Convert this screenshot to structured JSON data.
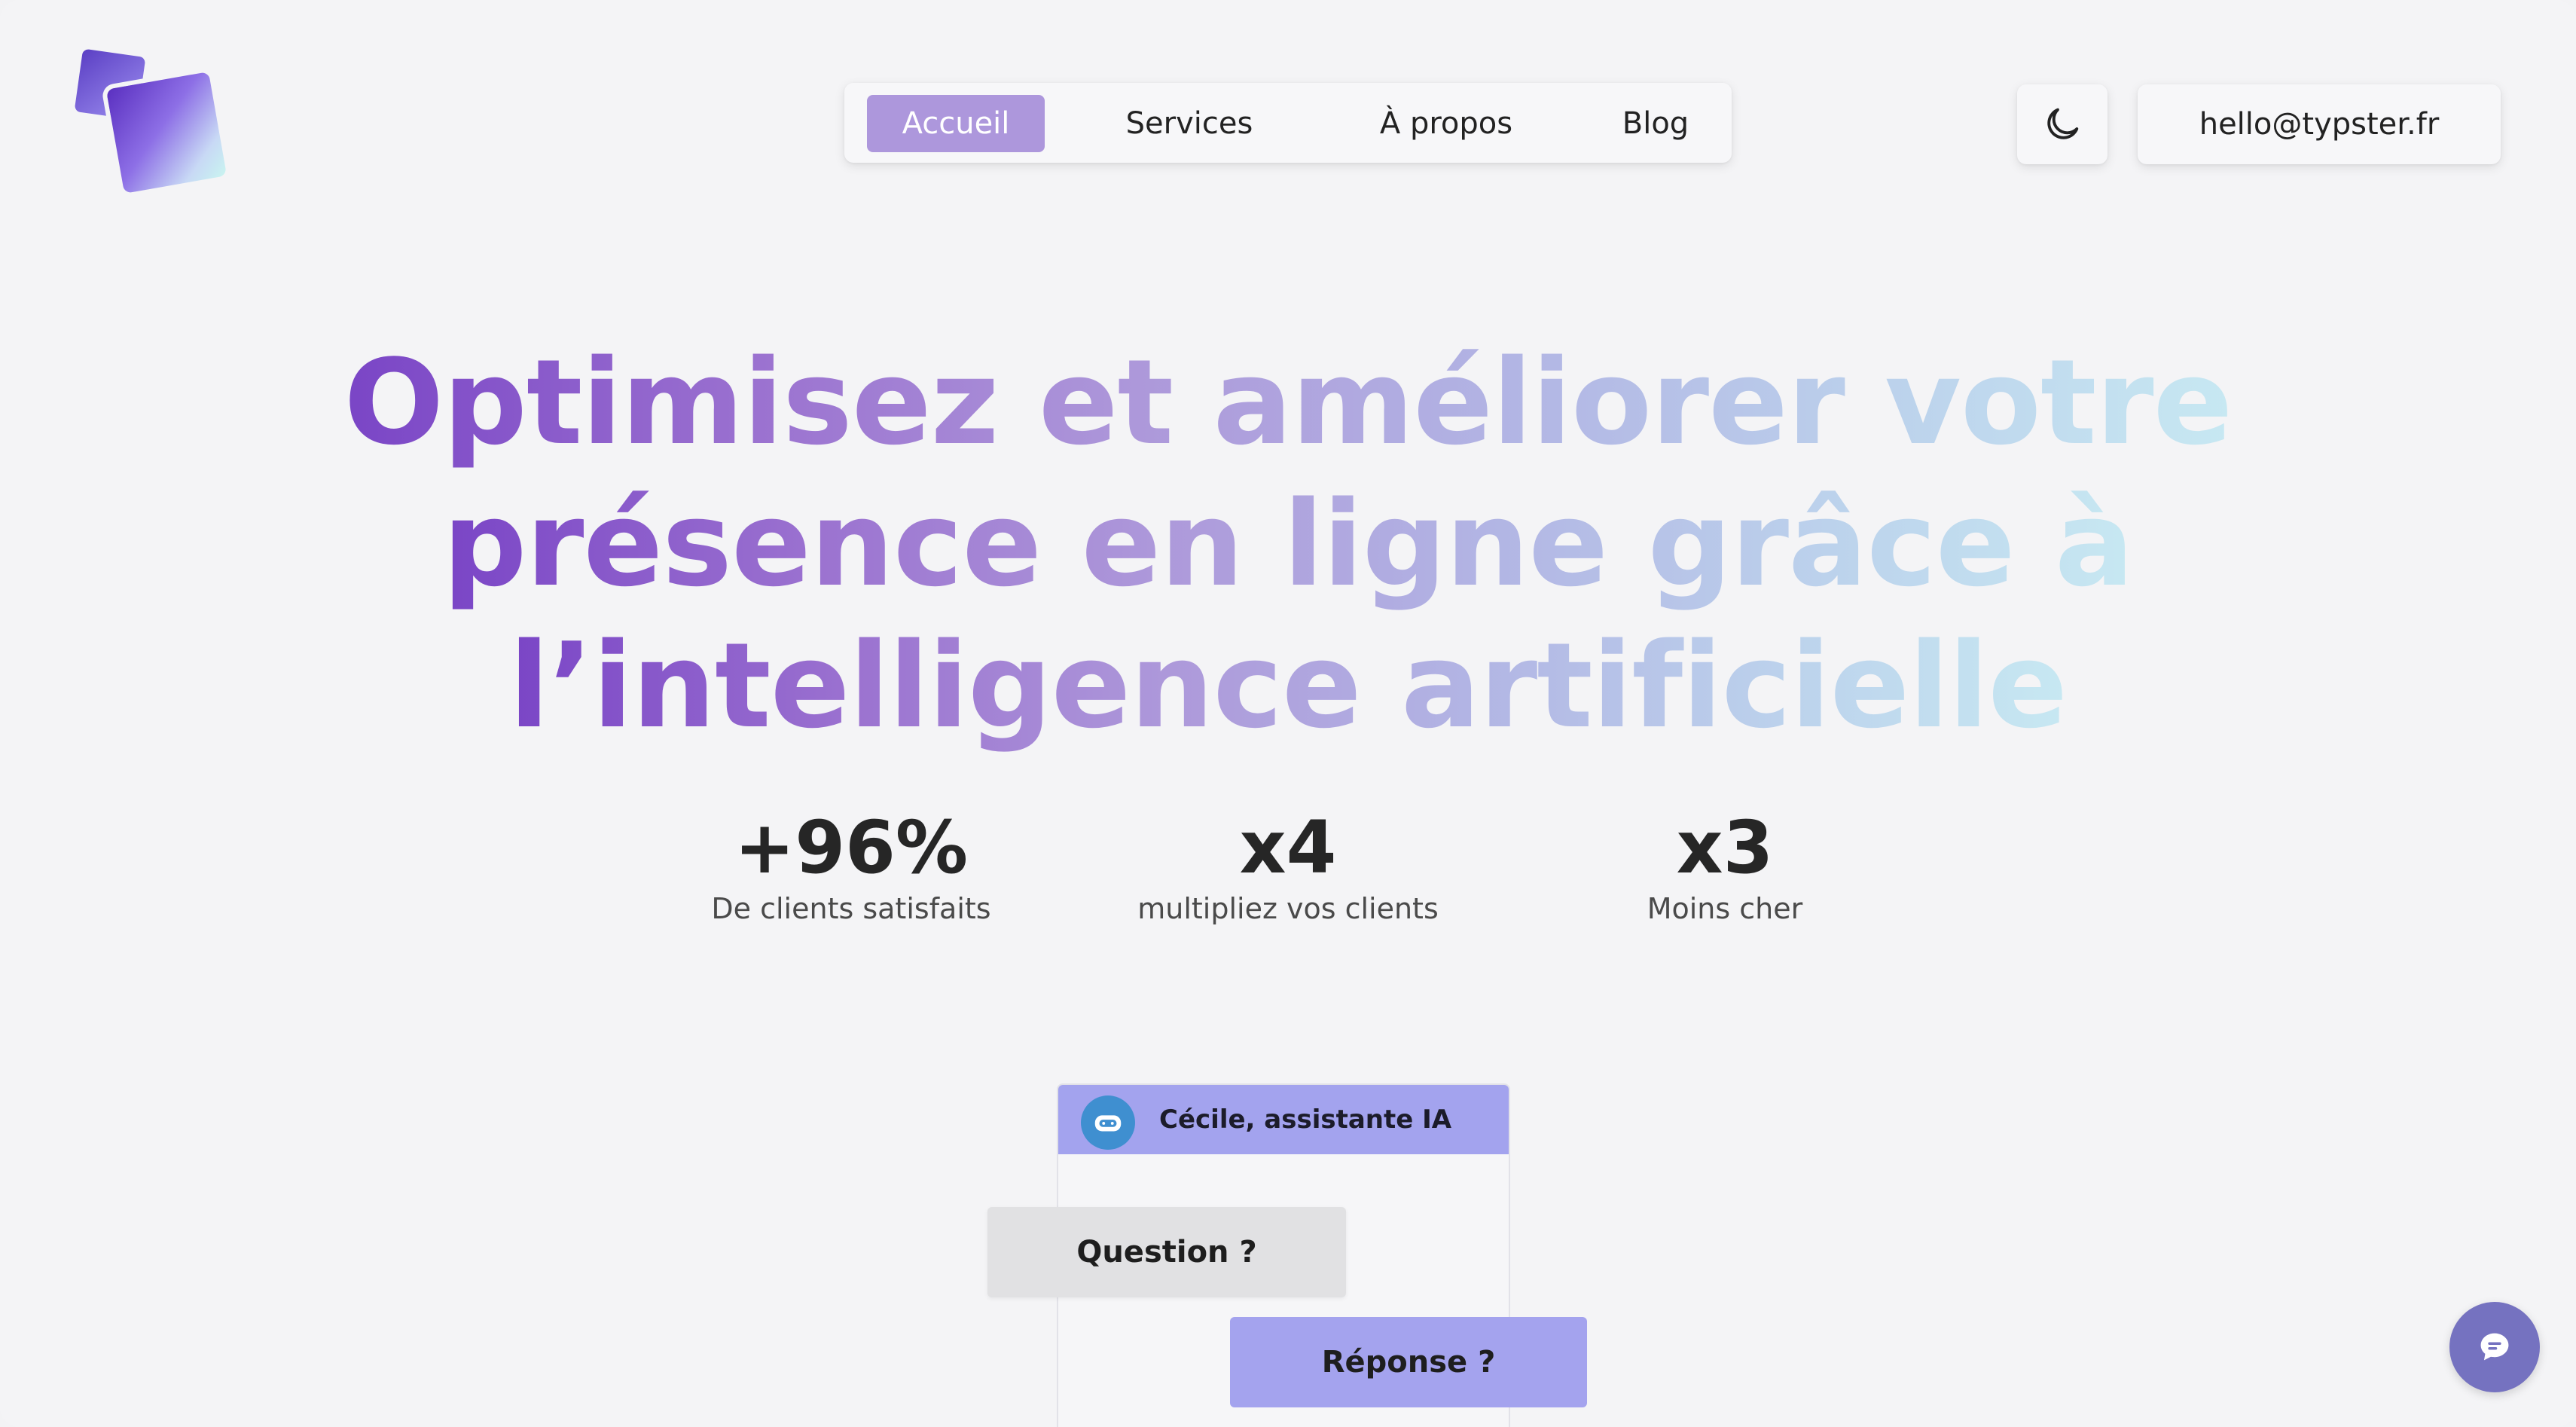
{
  "nav": {
    "items": [
      {
        "label": "Accueil",
        "active": true
      },
      {
        "label": "Services",
        "active": false
      },
      {
        "label": "À propos",
        "active": false
      },
      {
        "label": "Blog",
        "active": false
      }
    ]
  },
  "header": {
    "theme_toggle_icon": "moon-icon",
    "email": "hello@typster.fr"
  },
  "hero": {
    "lines": [
      "Optimisez et améliorer votre",
      "présence en ligne grâce à",
      "l’intelligence artificielle"
    ],
    "gradient": [
      "#7a45c6",
      "#ad98da",
      "#c7e8f2"
    ]
  },
  "stats": [
    {
      "value": "+96%",
      "label": "De clients satisfaits"
    },
    {
      "value": "x4",
      "label": "multipliez vos clients"
    },
    {
      "value": "x3",
      "label": "Moins cher"
    }
  ],
  "chat": {
    "title": "Cécile, assistante IA",
    "avatar_icon": "robot-icon",
    "question": "Question ?",
    "answer": "Réponse ?",
    "header_color": "#a3a3ee"
  },
  "fab": {
    "icon": "chat-bubble-icon",
    "color": "#7572c0"
  },
  "colors": {
    "accent": "#ad97dc",
    "background": "#f4f4f6"
  }
}
